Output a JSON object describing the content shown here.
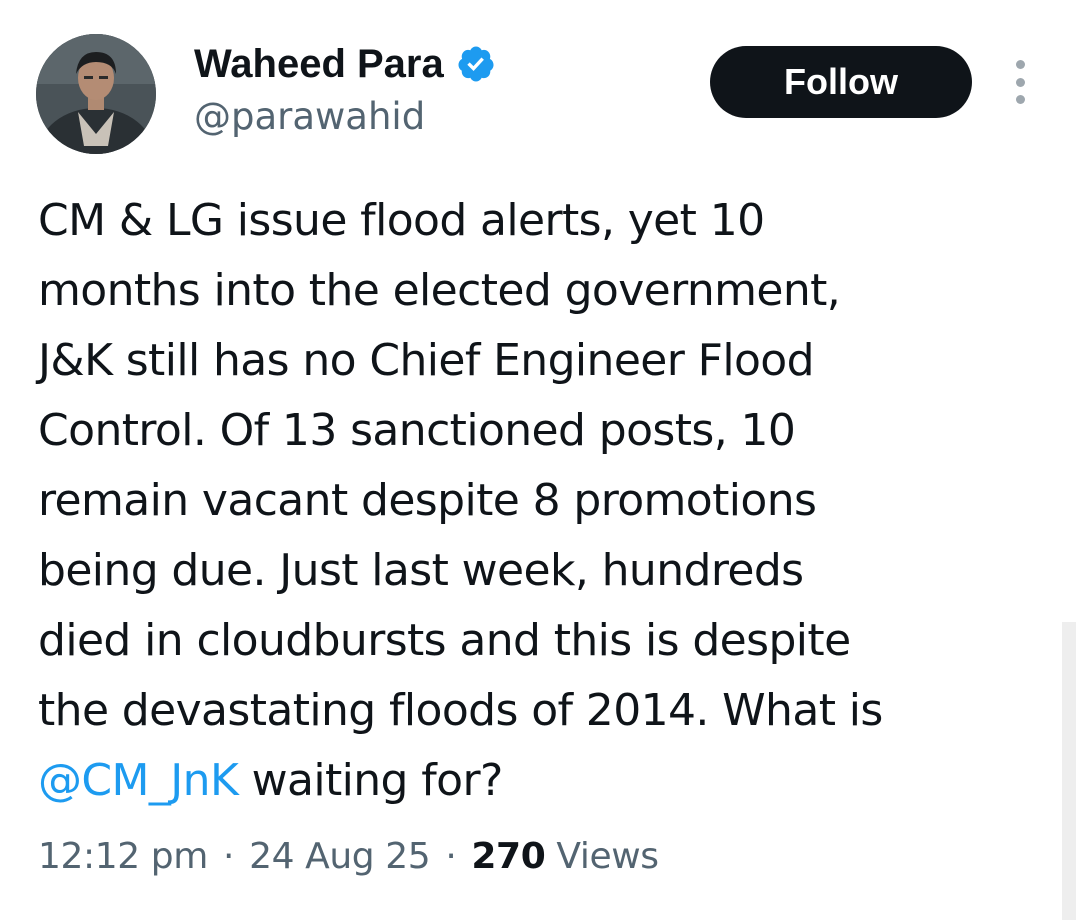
{
  "author": {
    "display_name": "Waheed Para",
    "handle": "@parawahid",
    "verified": true,
    "verified_color": "#1d9bf0",
    "avatar_icon": "profile-photo"
  },
  "actions": {
    "follow_label": "Follow",
    "more_icon": "more-vertical-icon"
  },
  "tweet": {
    "lines": [
      "CM & LG issue flood alerts, yet 10",
      "months into the elected government,",
      "J&K still has no Chief Engineer Flood",
      "Control. Of 13 sanctioned posts, 10",
      "remain vacant despite 8 promotions",
      "being due. Just last week, hundreds",
      "died in cloudbursts and this is despite",
      "the devastating floods of 2014. What is"
    ],
    "mention": "@CM_JnK",
    "last_line_rest": " waiting for?",
    "link_color": "#1d9bf0"
  },
  "meta": {
    "time": "12:12 pm",
    "separator": "·",
    "date": "24 Aug 25",
    "views_count": "270",
    "views_label": "Views"
  },
  "colors": {
    "text_primary": "#0f1419",
    "text_secondary": "#536471",
    "button_bg": "#0f1419"
  }
}
